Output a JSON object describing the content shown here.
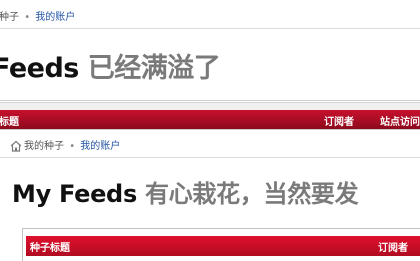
{
  "top": {
    "breadcrumb": {
      "seed": "种子",
      "separator": "•",
      "account": "我的账户"
    },
    "title": {
      "en": "Feeds",
      "cn": "已经满溢了"
    }
  },
  "header_bar": {
    "col_title": "标题",
    "col_subscribers": "订阅者",
    "col_site_visits": "站点访问"
  },
  "bottom": {
    "breadcrumb": {
      "my_seeds": "我的种子",
      "separator": "•",
      "account": "我的账户"
    },
    "title": {
      "en": "My Feeds",
      "cn": "有心栽花，当然要发"
    },
    "table_header": {
      "col_seed_title": "种子标题",
      "col_subscribers": "订阅者"
    }
  },
  "colors": {
    "red_bar": "#c8102e",
    "link": "#2455a4",
    "title_cn": "#7a7a7a"
  }
}
